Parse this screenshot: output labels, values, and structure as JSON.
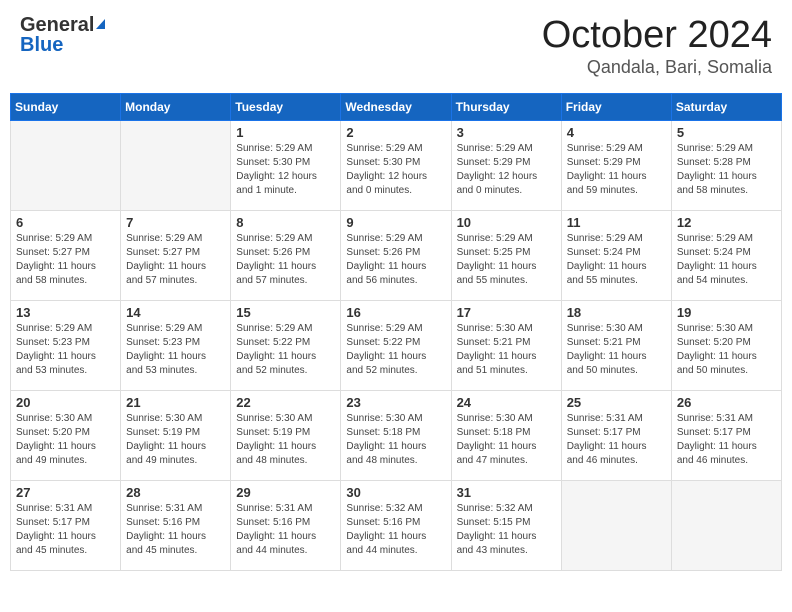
{
  "header": {
    "logo_general": "General",
    "logo_blue": "Blue",
    "month": "October 2024",
    "location": "Qandala, Bari, Somalia"
  },
  "weekdays": [
    "Sunday",
    "Monday",
    "Tuesday",
    "Wednesday",
    "Thursday",
    "Friday",
    "Saturday"
  ],
  "weeks": [
    [
      {
        "day": "",
        "info": ""
      },
      {
        "day": "",
        "info": ""
      },
      {
        "day": "1",
        "info": "Sunrise: 5:29 AM\nSunset: 5:30 PM\nDaylight: 12 hours and 1 minute."
      },
      {
        "day": "2",
        "info": "Sunrise: 5:29 AM\nSunset: 5:30 PM\nDaylight: 12 hours and 0 minutes."
      },
      {
        "day": "3",
        "info": "Sunrise: 5:29 AM\nSunset: 5:29 PM\nDaylight: 12 hours and 0 minutes."
      },
      {
        "day": "4",
        "info": "Sunrise: 5:29 AM\nSunset: 5:29 PM\nDaylight: 11 hours and 59 minutes."
      },
      {
        "day": "5",
        "info": "Sunrise: 5:29 AM\nSunset: 5:28 PM\nDaylight: 11 hours and 58 minutes."
      }
    ],
    [
      {
        "day": "6",
        "info": "Sunrise: 5:29 AM\nSunset: 5:27 PM\nDaylight: 11 hours and 58 minutes."
      },
      {
        "day": "7",
        "info": "Sunrise: 5:29 AM\nSunset: 5:27 PM\nDaylight: 11 hours and 57 minutes."
      },
      {
        "day": "8",
        "info": "Sunrise: 5:29 AM\nSunset: 5:26 PM\nDaylight: 11 hours and 57 minutes."
      },
      {
        "day": "9",
        "info": "Sunrise: 5:29 AM\nSunset: 5:26 PM\nDaylight: 11 hours and 56 minutes."
      },
      {
        "day": "10",
        "info": "Sunrise: 5:29 AM\nSunset: 5:25 PM\nDaylight: 11 hours and 55 minutes."
      },
      {
        "day": "11",
        "info": "Sunrise: 5:29 AM\nSunset: 5:24 PM\nDaylight: 11 hours and 55 minutes."
      },
      {
        "day": "12",
        "info": "Sunrise: 5:29 AM\nSunset: 5:24 PM\nDaylight: 11 hours and 54 minutes."
      }
    ],
    [
      {
        "day": "13",
        "info": "Sunrise: 5:29 AM\nSunset: 5:23 PM\nDaylight: 11 hours and 53 minutes."
      },
      {
        "day": "14",
        "info": "Sunrise: 5:29 AM\nSunset: 5:23 PM\nDaylight: 11 hours and 53 minutes."
      },
      {
        "day": "15",
        "info": "Sunrise: 5:29 AM\nSunset: 5:22 PM\nDaylight: 11 hours and 52 minutes."
      },
      {
        "day": "16",
        "info": "Sunrise: 5:29 AM\nSunset: 5:22 PM\nDaylight: 11 hours and 52 minutes."
      },
      {
        "day": "17",
        "info": "Sunrise: 5:30 AM\nSunset: 5:21 PM\nDaylight: 11 hours and 51 minutes."
      },
      {
        "day": "18",
        "info": "Sunrise: 5:30 AM\nSunset: 5:21 PM\nDaylight: 11 hours and 50 minutes."
      },
      {
        "day": "19",
        "info": "Sunrise: 5:30 AM\nSunset: 5:20 PM\nDaylight: 11 hours and 50 minutes."
      }
    ],
    [
      {
        "day": "20",
        "info": "Sunrise: 5:30 AM\nSunset: 5:20 PM\nDaylight: 11 hours and 49 minutes."
      },
      {
        "day": "21",
        "info": "Sunrise: 5:30 AM\nSunset: 5:19 PM\nDaylight: 11 hours and 49 minutes."
      },
      {
        "day": "22",
        "info": "Sunrise: 5:30 AM\nSunset: 5:19 PM\nDaylight: 11 hours and 48 minutes."
      },
      {
        "day": "23",
        "info": "Sunrise: 5:30 AM\nSunset: 5:18 PM\nDaylight: 11 hours and 48 minutes."
      },
      {
        "day": "24",
        "info": "Sunrise: 5:30 AM\nSunset: 5:18 PM\nDaylight: 11 hours and 47 minutes."
      },
      {
        "day": "25",
        "info": "Sunrise: 5:31 AM\nSunset: 5:17 PM\nDaylight: 11 hours and 46 minutes."
      },
      {
        "day": "26",
        "info": "Sunrise: 5:31 AM\nSunset: 5:17 PM\nDaylight: 11 hours and 46 minutes."
      }
    ],
    [
      {
        "day": "27",
        "info": "Sunrise: 5:31 AM\nSunset: 5:17 PM\nDaylight: 11 hours and 45 minutes."
      },
      {
        "day": "28",
        "info": "Sunrise: 5:31 AM\nSunset: 5:16 PM\nDaylight: 11 hours and 45 minutes."
      },
      {
        "day": "29",
        "info": "Sunrise: 5:31 AM\nSunset: 5:16 PM\nDaylight: 11 hours and 44 minutes."
      },
      {
        "day": "30",
        "info": "Sunrise: 5:32 AM\nSunset: 5:16 PM\nDaylight: 11 hours and 44 minutes."
      },
      {
        "day": "31",
        "info": "Sunrise: 5:32 AM\nSunset: 5:15 PM\nDaylight: 11 hours and 43 minutes."
      },
      {
        "day": "",
        "info": ""
      },
      {
        "day": "",
        "info": ""
      }
    ]
  ]
}
